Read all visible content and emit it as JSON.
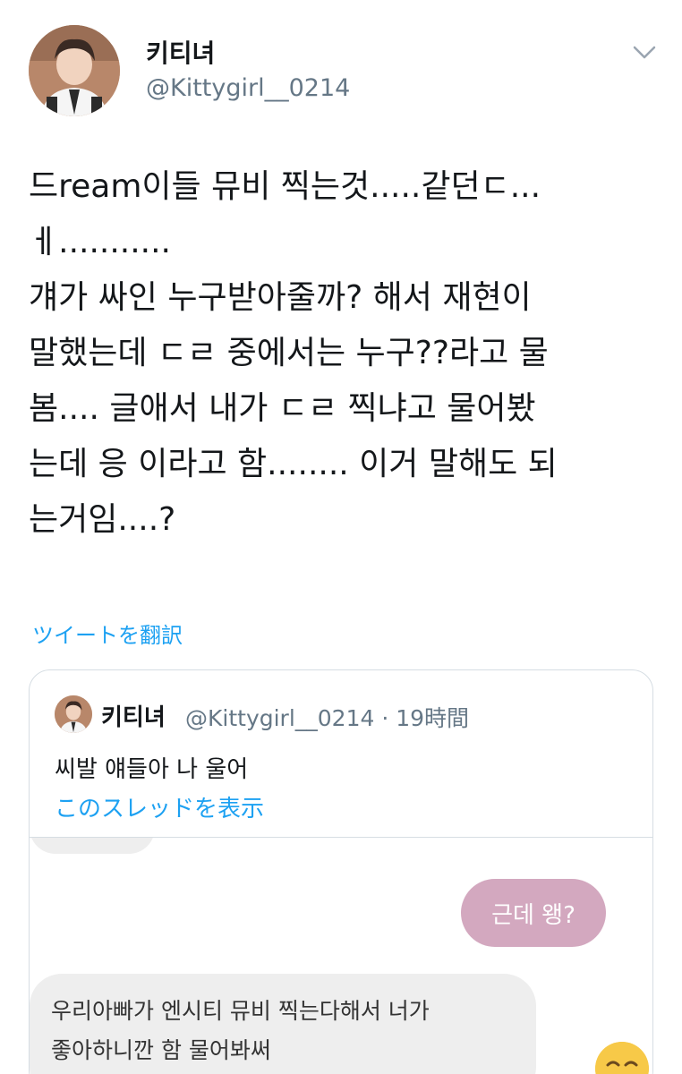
{
  "author": {
    "display_name": "키티녀",
    "handle": "@Kittygirl__0214"
  },
  "tweet": {
    "lines": [
      "드ream이들 뮤비 찍는것.....같던ㄷ...",
      "ㅔ...........",
      "걔가 싸인 누구받아줄까? 해서 재현이",
      "말했는데 ㄷㄹ 중에서는 누구??라고 물",
      "봄.... 글애서 내가 ㄷㄹ 찍냐고 물어봤",
      "는데 응 이라고 함........ 이거 말해도 되",
      "는거임....?"
    ],
    "translate_label": "ツイートを翻訳"
  },
  "quoted": {
    "display_name": "키티녀",
    "handle_time": "@Kittygirl__0214 · 19時間",
    "text": "씨발 얘들아 나 울어",
    "thread_link": "このスレッドを表示",
    "chat": {
      "right_bubble": "근데 왱?",
      "left_bubble_lines": [
        "우리아빠가 엔시티 뮤비 찍는다해서 너가",
        "좋아하니깐 함 물어봐써"
      ]
    }
  },
  "icons": {
    "menu": "chevron-down-icon",
    "emoji": "smiling-face-emoji"
  },
  "colors": {
    "link": "#1da1f2",
    "secondary_text": "#657786",
    "bubble_pink": "#d3a8bf",
    "bubble_gray": "#eeeeee"
  }
}
